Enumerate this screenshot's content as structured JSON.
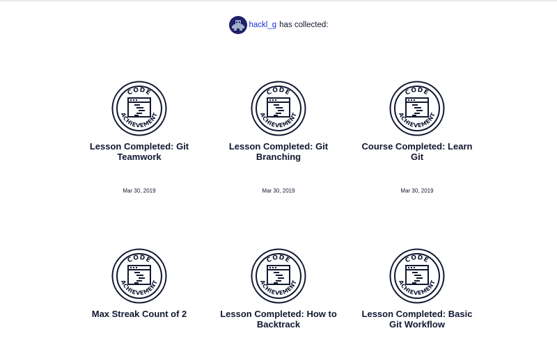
{
  "header": {
    "username": "hackl_g",
    "collected_text": "has collected:"
  },
  "badge": {
    "top_text": "CODE",
    "bottom_text": "ACHIEVEMENT"
  },
  "achievements": [
    {
      "title": "Lesson Completed: Git Teamwork",
      "date": "Mar 30, 2019"
    },
    {
      "title": "Lesson Completed: Git Branching",
      "date": "Mar 30, 2019"
    },
    {
      "title": "Course Completed: Learn Git",
      "date": "Mar 30, 2019"
    },
    {
      "title": "Max Streak Count of 2",
      "date": ""
    },
    {
      "title": "Lesson Completed: How to Backtrack",
      "date": ""
    },
    {
      "title": "Lesson Completed: Basic Git Workflow",
      "date": ""
    }
  ],
  "colors": {
    "text": "#10162f",
    "link": "#1c2ee0",
    "avatar_bg": "#1f1f6a"
  }
}
